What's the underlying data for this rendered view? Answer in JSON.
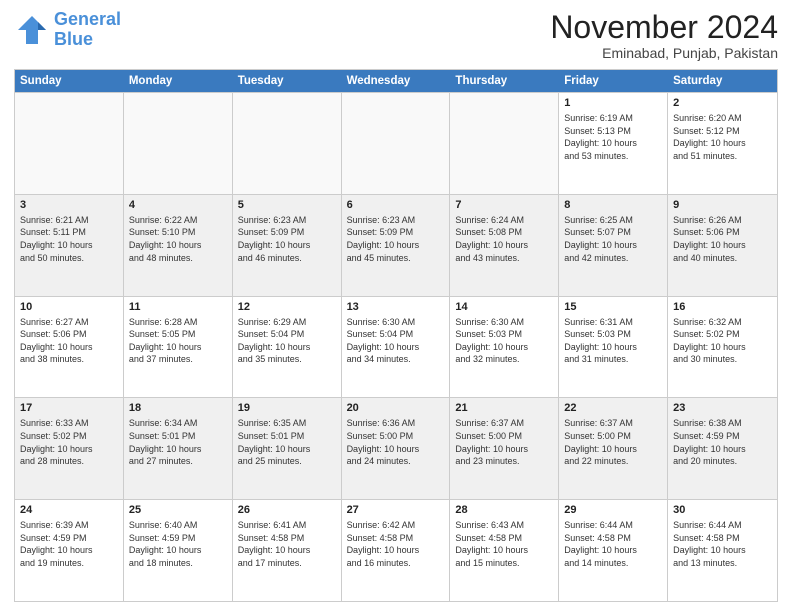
{
  "header": {
    "logo_line1": "General",
    "logo_line2": "Blue",
    "month_title": "November 2024",
    "location": "Eminabad, Punjab, Pakistan"
  },
  "calendar": {
    "days_of_week": [
      "Sunday",
      "Monday",
      "Tuesday",
      "Wednesday",
      "Thursday",
      "Friday",
      "Saturday"
    ],
    "rows": [
      [
        {
          "day": "",
          "info": "",
          "empty": true
        },
        {
          "day": "",
          "info": "",
          "empty": true
        },
        {
          "day": "",
          "info": "",
          "empty": true
        },
        {
          "day": "",
          "info": "",
          "empty": true
        },
        {
          "day": "",
          "info": "",
          "empty": true
        },
        {
          "day": "1",
          "info": "Sunrise: 6:19 AM\nSunset: 5:13 PM\nDaylight: 10 hours\nand 53 minutes."
        },
        {
          "day": "2",
          "info": "Sunrise: 6:20 AM\nSunset: 5:12 PM\nDaylight: 10 hours\nand 51 minutes."
        }
      ],
      [
        {
          "day": "3",
          "info": "Sunrise: 6:21 AM\nSunset: 5:11 PM\nDaylight: 10 hours\nand 50 minutes."
        },
        {
          "day": "4",
          "info": "Sunrise: 6:22 AM\nSunset: 5:10 PM\nDaylight: 10 hours\nand 48 minutes."
        },
        {
          "day": "5",
          "info": "Sunrise: 6:23 AM\nSunset: 5:09 PM\nDaylight: 10 hours\nand 46 minutes."
        },
        {
          "day": "6",
          "info": "Sunrise: 6:23 AM\nSunset: 5:09 PM\nDaylight: 10 hours\nand 45 minutes."
        },
        {
          "day": "7",
          "info": "Sunrise: 6:24 AM\nSunset: 5:08 PM\nDaylight: 10 hours\nand 43 minutes."
        },
        {
          "day": "8",
          "info": "Sunrise: 6:25 AM\nSunset: 5:07 PM\nDaylight: 10 hours\nand 42 minutes."
        },
        {
          "day": "9",
          "info": "Sunrise: 6:26 AM\nSunset: 5:06 PM\nDaylight: 10 hours\nand 40 minutes."
        }
      ],
      [
        {
          "day": "10",
          "info": "Sunrise: 6:27 AM\nSunset: 5:06 PM\nDaylight: 10 hours\nand 38 minutes."
        },
        {
          "day": "11",
          "info": "Sunrise: 6:28 AM\nSunset: 5:05 PM\nDaylight: 10 hours\nand 37 minutes."
        },
        {
          "day": "12",
          "info": "Sunrise: 6:29 AM\nSunset: 5:04 PM\nDaylight: 10 hours\nand 35 minutes."
        },
        {
          "day": "13",
          "info": "Sunrise: 6:30 AM\nSunset: 5:04 PM\nDaylight: 10 hours\nand 34 minutes."
        },
        {
          "day": "14",
          "info": "Sunrise: 6:30 AM\nSunset: 5:03 PM\nDaylight: 10 hours\nand 32 minutes."
        },
        {
          "day": "15",
          "info": "Sunrise: 6:31 AM\nSunset: 5:03 PM\nDaylight: 10 hours\nand 31 minutes."
        },
        {
          "day": "16",
          "info": "Sunrise: 6:32 AM\nSunset: 5:02 PM\nDaylight: 10 hours\nand 30 minutes."
        }
      ],
      [
        {
          "day": "17",
          "info": "Sunrise: 6:33 AM\nSunset: 5:02 PM\nDaylight: 10 hours\nand 28 minutes."
        },
        {
          "day": "18",
          "info": "Sunrise: 6:34 AM\nSunset: 5:01 PM\nDaylight: 10 hours\nand 27 minutes."
        },
        {
          "day": "19",
          "info": "Sunrise: 6:35 AM\nSunset: 5:01 PM\nDaylight: 10 hours\nand 25 minutes."
        },
        {
          "day": "20",
          "info": "Sunrise: 6:36 AM\nSunset: 5:00 PM\nDaylight: 10 hours\nand 24 minutes."
        },
        {
          "day": "21",
          "info": "Sunrise: 6:37 AM\nSunset: 5:00 PM\nDaylight: 10 hours\nand 23 minutes."
        },
        {
          "day": "22",
          "info": "Sunrise: 6:37 AM\nSunset: 5:00 PM\nDaylight: 10 hours\nand 22 minutes."
        },
        {
          "day": "23",
          "info": "Sunrise: 6:38 AM\nSunset: 4:59 PM\nDaylight: 10 hours\nand 20 minutes."
        }
      ],
      [
        {
          "day": "24",
          "info": "Sunrise: 6:39 AM\nSunset: 4:59 PM\nDaylight: 10 hours\nand 19 minutes."
        },
        {
          "day": "25",
          "info": "Sunrise: 6:40 AM\nSunset: 4:59 PM\nDaylight: 10 hours\nand 18 minutes."
        },
        {
          "day": "26",
          "info": "Sunrise: 6:41 AM\nSunset: 4:58 PM\nDaylight: 10 hours\nand 17 minutes."
        },
        {
          "day": "27",
          "info": "Sunrise: 6:42 AM\nSunset: 4:58 PM\nDaylight: 10 hours\nand 16 minutes."
        },
        {
          "day": "28",
          "info": "Sunrise: 6:43 AM\nSunset: 4:58 PM\nDaylight: 10 hours\nand 15 minutes."
        },
        {
          "day": "29",
          "info": "Sunrise: 6:44 AM\nSunset: 4:58 PM\nDaylight: 10 hours\nand 14 minutes."
        },
        {
          "day": "30",
          "info": "Sunrise: 6:44 AM\nSunset: 4:58 PM\nDaylight: 10 hours\nand 13 minutes."
        }
      ]
    ]
  }
}
